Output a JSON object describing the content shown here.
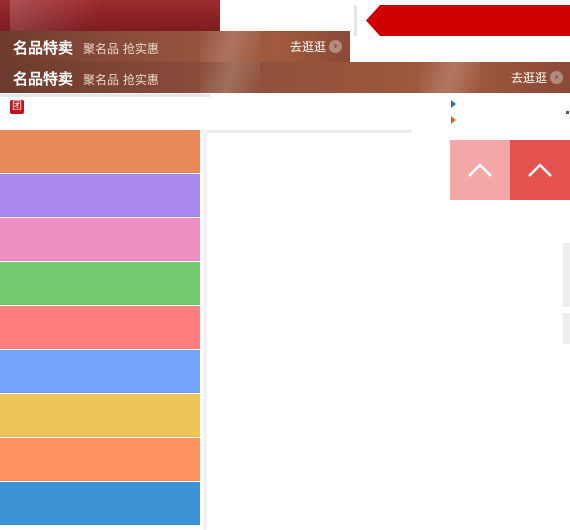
{
  "banners": [
    {
      "title": "名品特卖",
      "subtitle": "聚名品 抢实惠",
      "link": "去逛逛",
      "chevron": "›"
    },
    {
      "title": "名品特卖",
      "subtitle": "聚名品 抢实惠",
      "link": "去逛逛",
      "chevron": "›"
    }
  ],
  "tuan_icon_label": "团",
  "colors": {
    "accent_red": "#d10000",
    "banner_brown": "#8d4f3b",
    "up_light": "#f3a7a6",
    "up_dark": "#e65250"
  },
  "color_list": [
    {
      "color": "#e58a58"
    },
    {
      "color": "#a888ee"
    },
    {
      "color": "#ee8fc3"
    },
    {
      "color": "#72cc6e"
    },
    {
      "color": "#ff7f7f"
    },
    {
      "color": "#72a4fb"
    },
    {
      "color": "#efc55a"
    },
    {
      "color": "#ff9260"
    },
    {
      "color": "#3c93d6"
    }
  ],
  "icons": {
    "up_light": "chevron-up-icon",
    "up_dark": "chevron-up-icon"
  }
}
